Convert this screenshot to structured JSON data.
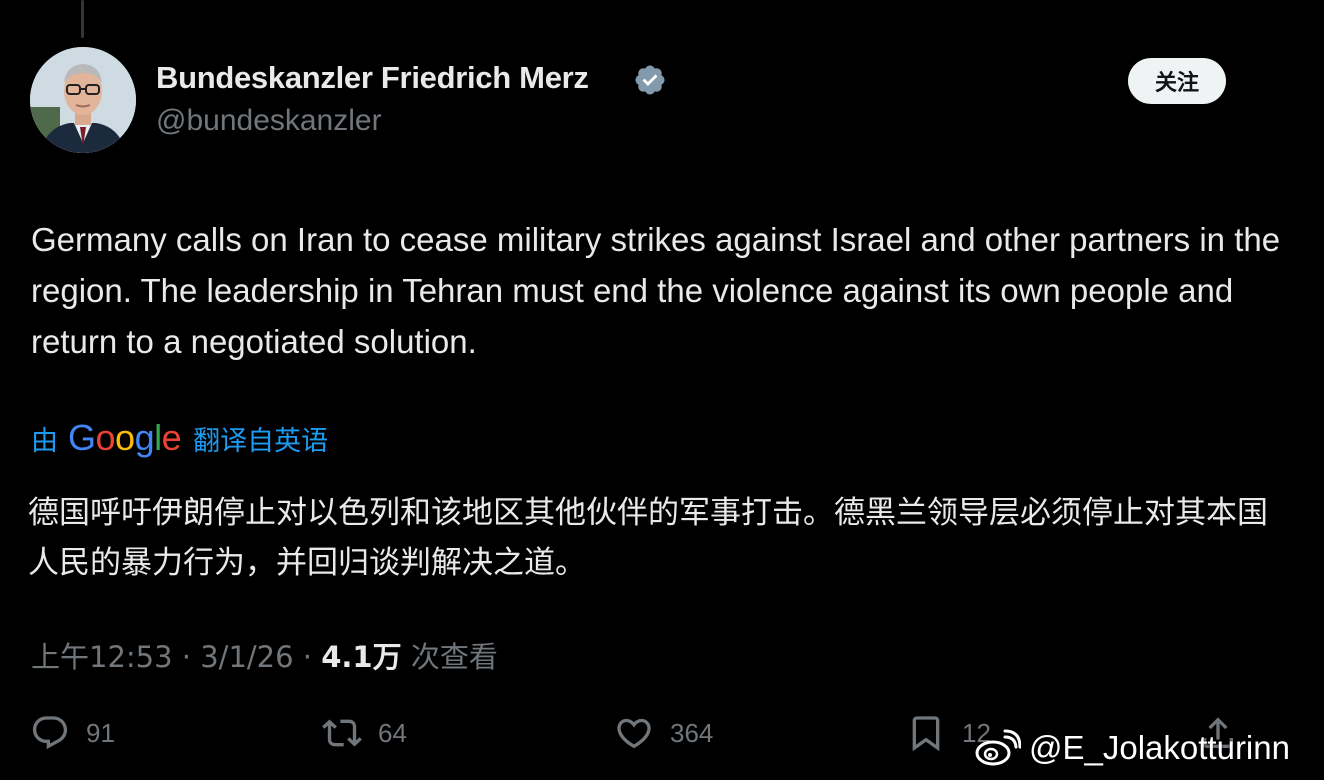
{
  "author": {
    "display_name": "Bundeskanzler Friedrich Merz",
    "handle": "@bundeskanzler",
    "verified_icon": "verified-badge-icon"
  },
  "follow_button": {
    "label": "关注"
  },
  "tweet": {
    "text": "Germany calls on Iran to cease military strikes against Israel and other partners in the region. The leadership in Tehran must end the violence against its own people and return to a negotiated solution."
  },
  "translation": {
    "prefix": "由",
    "provider": "Google",
    "suffix": "翻译自英语",
    "text": "德国呼吁伊朗停止对以色列和该地区其他伙伴的军事打击。德黑兰领导层必须停止对其本国人民的暴力行为，并回归谈判解决之道。"
  },
  "meta": {
    "time": "上午12:53",
    "separator": "·",
    "date": "3/1/26",
    "views_count": "4.1万",
    "views_label": "次查看"
  },
  "actions": {
    "replies": "91",
    "reposts": "64",
    "likes": "364",
    "bookmarks": "12"
  },
  "watermark": {
    "text": "@E_Jolakotturinn"
  },
  "colors": {
    "background": "#000000",
    "text_primary": "#e7e9ea",
    "text_secondary": "#71767b",
    "link_blue": "#1d9bf0",
    "verified_badge": "#829aab",
    "follow_bg": "#eff3f4"
  }
}
